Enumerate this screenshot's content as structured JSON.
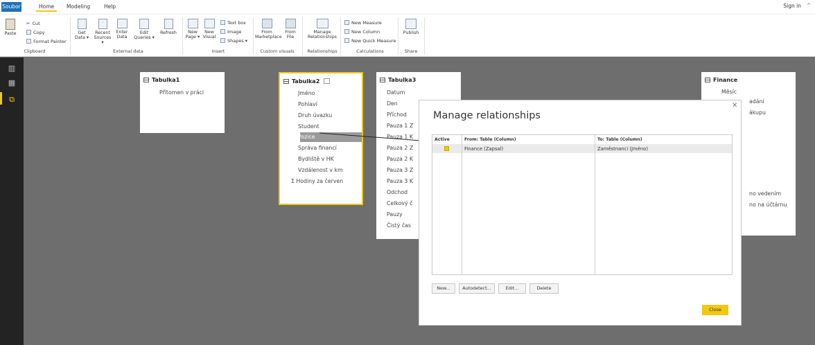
{
  "menu": {
    "tabs": [
      {
        "label": "Soubor"
      },
      {
        "label": "Home"
      },
      {
        "label": "Modeling"
      },
      {
        "label": "Help"
      }
    ],
    "sign_in": "Sign in"
  },
  "ribbon": {
    "clipboard": {
      "paste": "Paste",
      "cut": "Cut",
      "copy": "Copy",
      "format_painter": "Format Painter",
      "label": "Clipboard"
    },
    "external_data": {
      "get_data_1": "Get",
      "get_data_2": "Data ▾",
      "recent_1": "Recent",
      "recent_2": "Sources ▾",
      "enter_1": "Enter",
      "enter_2": "Data",
      "edit_1": "Edit",
      "edit_2": "Queries ▾",
      "refresh": "Refresh",
      "label": "External data"
    },
    "insert": {
      "new_page_1": "New",
      "new_page_2": "Page ▾",
      "new_visual_1": "New",
      "new_visual_2": "Visual",
      "text_box": "Text box",
      "image": "Image",
      "shapes": "Shapes ▾",
      "label": "Insert"
    },
    "custom_visuals": {
      "marketplace_1": "From",
      "marketplace_2": "Marketplace",
      "file_1": "From",
      "file_2": "File",
      "label": "Custom visuals"
    },
    "relationships": {
      "manage_1": "Manage",
      "manage_2": "Relationships",
      "label": "Relationships"
    },
    "calculations": {
      "new_measure": "New Measure",
      "new_column": "New Column",
      "new_quick_measure": "New Quick Measure",
      "label": "Calculations"
    },
    "share": {
      "publish": "Publish",
      "label": "Share"
    }
  },
  "tables": {
    "tabulka1": {
      "title": "Tabulka1",
      "fields": [
        "Přítomen v práci"
      ]
    },
    "tabulka2": {
      "title": "Tabulka2",
      "fields": [
        "Jméno",
        "Pohlaví",
        "Druh úvazku",
        "Student",
        "Pozice",
        "Správa financí",
        "Bydliště v HK",
        "Vzdálenost v km",
        "Σ Hodiny za červen"
      ]
    },
    "tabulka3": {
      "title": "Tabulka3",
      "fields": [
        "Datum",
        "Den",
        "Příchod",
        "Pauza 1 Z",
        "Pauza 1 K",
        "Pauza 2 Z",
        "Pauza 2 K",
        "Pauza 3 Z",
        "Pauza 3 K",
        "Odchod",
        "Celkový č",
        "Pauzy",
        "Čistý čas"
      ]
    },
    "finance": {
      "title": "Finance",
      "fields": [
        "Měsíc",
        "adání",
        "ákupu",
        "no vedením",
        "no na účtárnu"
      ]
    }
  },
  "dialog": {
    "title": "Manage relationships",
    "columns": [
      "Active",
      "From: Table (Column)",
      "To: Table (Column)"
    ],
    "rows": [
      {
        "active": true,
        "from": "Finance (Zapsal)",
        "to": "Zaměstnanci (Jméno)"
      }
    ],
    "buttons": {
      "new": "New...",
      "autodetect": "Autodetect...",
      "edit": "Edit...",
      "delete": "Delete",
      "close": "Close"
    }
  },
  "colors": {
    "accent": "#f2c811",
    "file_tab": "#1e6fb8",
    "canvas": "#6e6e6e",
    "rail": "#232323"
  }
}
